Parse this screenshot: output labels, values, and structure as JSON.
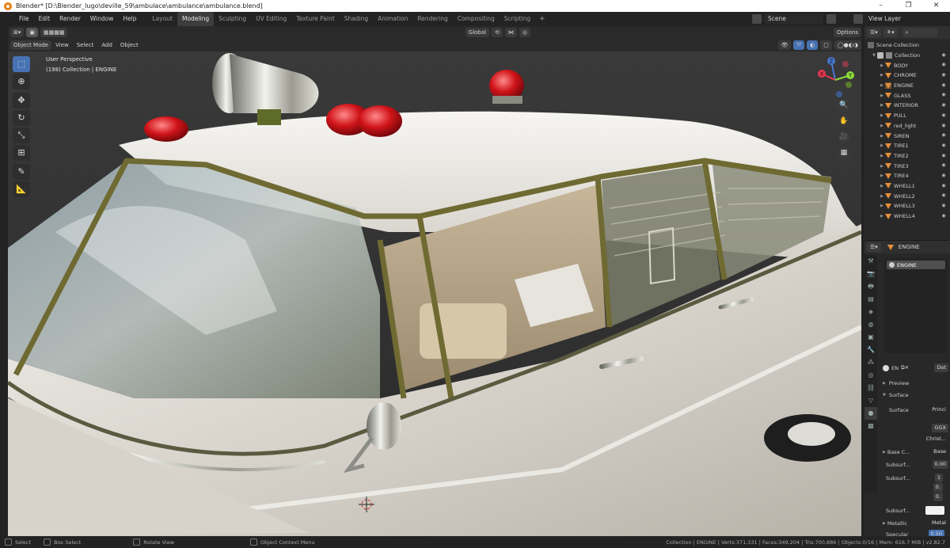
{
  "window": {
    "title": "Blender* [D:\\Blender_lugo\\deville_59\\ambulace\\ambulance\\ambulance.blend]",
    "minimize": "–",
    "maximize": "❐",
    "close": "✕"
  },
  "menubar": {
    "items": [
      "File",
      "Edit",
      "Render",
      "Window",
      "Help"
    ]
  },
  "workspaces": {
    "tabs": [
      "Layout",
      "Modeling",
      "Sculpting",
      "UV Editing",
      "Texture Paint",
      "Shading",
      "Animation",
      "Rendering",
      "Compositing",
      "Scripting"
    ],
    "active": "Modeling",
    "add": "+"
  },
  "scene": {
    "name": "Scene"
  },
  "view_layer": {
    "name": "View Layer"
  },
  "viewport": {
    "mode": "Object Mode",
    "menus": [
      "View",
      "Select",
      "Add",
      "Object"
    ],
    "transform_orientation": "Global",
    "options_label": "Options",
    "overlay_text_line1": "User Perspective",
    "overlay_text_line2": "(198) Collection | ENGINE",
    "gizmo_axes": {
      "z": "Z",
      "y": "Y",
      "x": "X"
    }
  },
  "outliner": {
    "root": "Scene Collection",
    "collection": "Collection",
    "objects": [
      "BODY",
      "CHROME",
      "ENGINE",
      "GLASS",
      "INTERIOR",
      "PULL",
      "red_light",
      "SIREN",
      "TIRE1",
      "TIRE2",
      "TIRE3",
      "TIRE4",
      "WHELL1",
      "WHELL2",
      "WHELL3",
      "WHELL4"
    ],
    "selected": "ENGINE"
  },
  "properties": {
    "object_name": "ENGINE",
    "material_slot": "ENGINE",
    "material_short": "EN",
    "dot_label": "Dot",
    "preview_label": "Preview",
    "surface_panel": "Surface",
    "surface_label": "Surface",
    "surface_value": "Princi",
    "distribution": "GGX",
    "subsurface_method": "Christ...",
    "base_color_label": "Base C...",
    "base_color_value": "Base",
    "subsurface_label": "Subsurf...",
    "subsurface_value": "0.00",
    "subsurface_radius_label": "Subsurf...",
    "subsurface_radius_values": [
      "1",
      "0.",
      "0."
    ],
    "subsurface_color_label": "Subsurf...",
    "metallic_label": "Metallic",
    "metallic_value": "Metal",
    "specular_label": "Specular",
    "specular_value": "0.50"
  },
  "statusbar": {
    "select": "Select",
    "box_select": "Box Select",
    "rotate_view": "Rotate View",
    "context_menu": "Object Context Menu",
    "stats": "Collection | ENGINE | Verts:371,331 | Faces:349,204 | Tris:700,886 | Objects:0/16 | Mem: 616.7 MiB | v2.82.7"
  },
  "colors": {
    "accent_blue": "#4772b3",
    "object_orange": "#e58e3d",
    "car_body": "#e8e6e2",
    "chrome_trim": "#6f6a32"
  }
}
